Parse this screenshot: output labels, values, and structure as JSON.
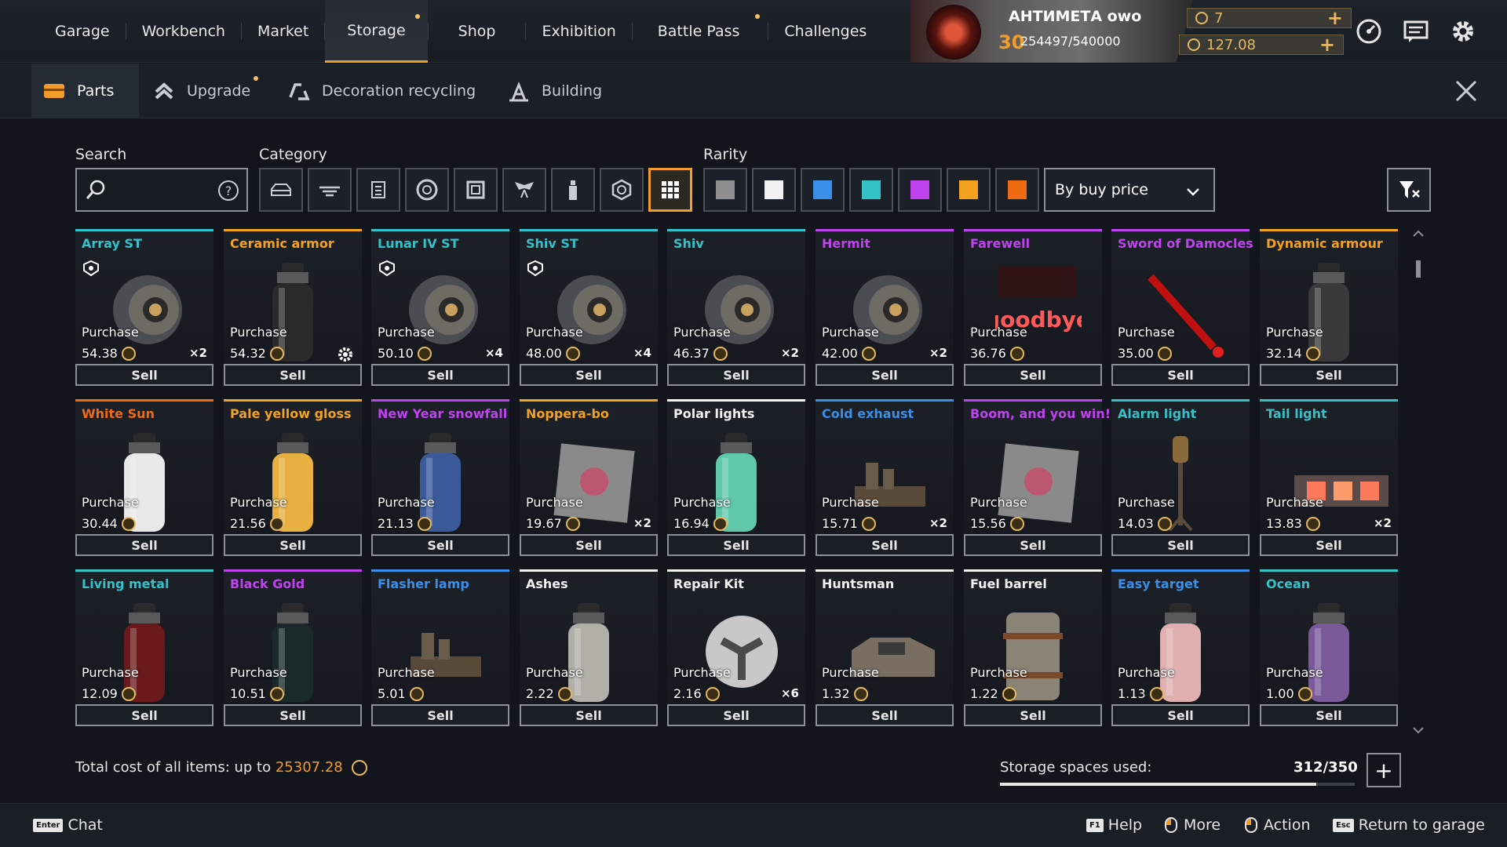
{
  "topnav": {
    "tabs": [
      "Garage",
      "Workbench",
      "Market",
      "Storage",
      "Shop",
      "Exhibition",
      "Battle Pass",
      "Challenges"
    ],
    "active": "Storage"
  },
  "profile": {
    "name": "АНТИМЕТА owo",
    "level": "30",
    "xp": "254497/540000"
  },
  "currency": {
    "premium": "7",
    "coins": "127.08"
  },
  "subtabs": [
    "Parts",
    "Upgrade",
    "Decoration recycling",
    "Building"
  ],
  "filters": {
    "search_label": "Search",
    "category_label": "Category",
    "rarity_label": "Rarity",
    "sort": "By buy price",
    "rarity_colors": [
      "#8f8f8f",
      "#f2f2f2",
      "#3a8fe8",
      "#35c1c8",
      "#c043f0",
      "#f3a21f",
      "#f06a12"
    ]
  },
  "labels": {
    "purchase": "Purchase",
    "sell": "Sell"
  },
  "items": [
    {
      "name": "Array ST",
      "price": "54.38",
      "count": "×2",
      "color": "#35c1c8",
      "art": "wheel"
    },
    {
      "name": "Ceramic armor",
      "price": "54.32",
      "count": "",
      "color": "#f3a21f",
      "art": "can",
      "can": "#2a2a2a"
    },
    {
      "name": "Lunar IV ST",
      "price": "50.10",
      "count": "×4",
      "color": "#35c1c8",
      "art": "wheel"
    },
    {
      "name": "Shiv ST",
      "price": "48.00",
      "count": "×4",
      "color": "#35c1c8",
      "art": "wheel"
    },
    {
      "name": "Shiv",
      "price": "46.37",
      "count": "×2",
      "color": "#35c1c8",
      "art": "wheel"
    },
    {
      "name": "Hermit",
      "price": "42.00",
      "count": "×2",
      "color": "#c043f0",
      "art": "wheel"
    },
    {
      "name": "Farewell",
      "price": "36.76",
      "count": "",
      "color": "#c043f0",
      "art": "text",
      "text": "goodbye"
    },
    {
      "name": "Sword of Damocles",
      "price": "35.00",
      "count": "",
      "color": "#c043f0",
      "art": "sword"
    },
    {
      "name": "Dynamic armour",
      "price": "32.14",
      "count": "",
      "color": "#f3a21f",
      "art": "can",
      "can": "#3a3a3a"
    },
    {
      "name": "White Sun",
      "price": "30.44",
      "count": "",
      "color": "#f06a12",
      "art": "can",
      "can": "#e8e8e8"
    },
    {
      "name": "Pale yellow gloss",
      "price": "21.56",
      "count": "",
      "color": "#f3a21f",
      "art": "can",
      "can": "#e8b040"
    },
    {
      "name": "New Year snowfall",
      "price": "21.13",
      "count": "",
      "color": "#c043f0",
      "art": "can",
      "can": "#3a5a9a"
    },
    {
      "name": "Noppera-bo",
      "price": "19.67",
      "count": "×2",
      "color": "#f3a21f",
      "art": "decal"
    },
    {
      "name": "Polar lights",
      "price": "16.94",
      "count": "",
      "color": "#f2f2f2",
      "art": "can",
      "can": "#5fc8a8"
    },
    {
      "name": "Cold exhaust",
      "price": "15.71",
      "count": "×2",
      "color": "#3a8fe8",
      "art": "part"
    },
    {
      "name": "Boom, and you win!",
      "price": "15.56",
      "count": "",
      "color": "#c043f0",
      "art": "decal"
    },
    {
      "name": "Alarm light",
      "price": "14.03",
      "count": "",
      "color": "#35c1c8",
      "art": "lamp"
    },
    {
      "name": "Tail light",
      "price": "13.83",
      "count": "×2",
      "color": "#35c1c8",
      "art": "taillight"
    },
    {
      "name": "Living metal",
      "price": "12.09",
      "count": "",
      "color": "#35c1c8",
      "art": "can",
      "can": "#6a1a1a"
    },
    {
      "name": "Black Gold",
      "price": "10.51",
      "count": "",
      "color": "#c043f0",
      "art": "can",
      "can": "#1a2a2a"
    },
    {
      "name": "Flasher lamp",
      "price": "5.01",
      "count": "",
      "color": "#3a8fe8",
      "art": "part"
    },
    {
      "name": "Ashes",
      "price": "2.22",
      "count": "",
      "color": "#f2f2f2",
      "art": "can",
      "can": "#b0b0a8"
    },
    {
      "name": "Repair Kit",
      "price": "2.16",
      "count": "×6",
      "color": "#f2f2f2",
      "art": "disc"
    },
    {
      "name": "Huntsman",
      "price": "1.32",
      "count": "",
      "color": "#f2f2f2",
      "art": "cabin"
    },
    {
      "name": "Fuel barrel",
      "price": "1.22",
      "count": "",
      "color": "#f2f2f2",
      "art": "barrel"
    },
    {
      "name": "Easy target",
      "price": "1.13",
      "count": "",
      "color": "#3a8fe8",
      "art": "can",
      "can": "#e0b0b0"
    },
    {
      "name": "Ocean",
      "price": "1.00",
      "count": "",
      "color": "#35c1c8",
      "art": "can",
      "can": "#7a5a9a"
    }
  ],
  "footer": {
    "total_label": "Total cost of all items: up to",
    "total_value": "25307.28",
    "storage_label": "Storage spaces used:",
    "storage_value": "312/350",
    "storage_fraction": 0.891
  },
  "bottombar": {
    "chat_key": "Enter",
    "chat": "Chat",
    "help_key": "F1",
    "help": "Help",
    "more": "More",
    "action": "Action",
    "return_key": "Esc",
    "return": "Return to garage"
  }
}
